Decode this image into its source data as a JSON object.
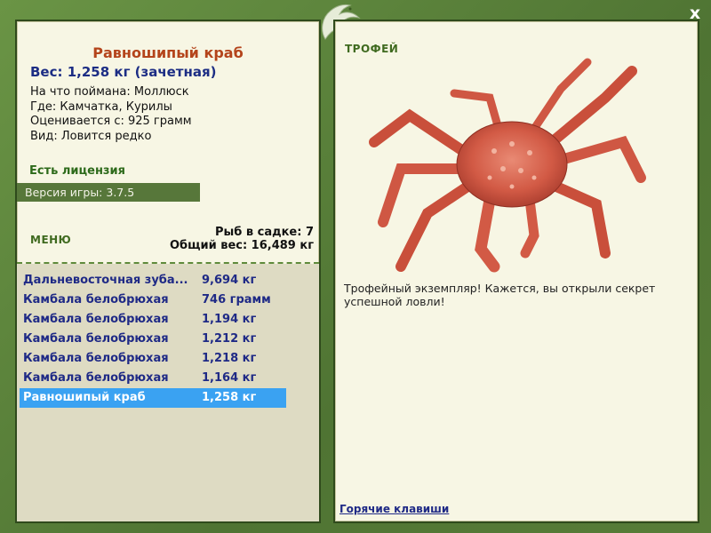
{
  "window": {
    "close_label": "x"
  },
  "fish": {
    "title": "Равношипый краб",
    "weight_line": "Вес: 1,258 кг (зачетная)",
    "info_lines": [
      "На что поймана: Моллюск",
      "Где: Камчатка, Курилы",
      "Оценивается с: 925 грамм",
      "Вид: Ловится редко"
    ]
  },
  "license_label": "Есть лицензия",
  "version_label": "Версия игры: 3.7.5",
  "menu_label": "МЕНЮ",
  "stats": {
    "fish_in_cage": "Рыб в садке: 7",
    "total_weight": "Общий вес: 16,489 кг"
  },
  "catch_list": [
    {
      "name": "Дальневосточная зуба...",
      "weight": "9,694 кг"
    },
    {
      "name": "Камбала белобрюхая",
      "weight": "746 грамм"
    },
    {
      "name": "Камбала белобрюхая",
      "weight": "1,194 кг"
    },
    {
      "name": "Камбала белобрюхая",
      "weight": "1,212 кг"
    },
    {
      "name": "Камбала белобрюхая",
      "weight": "1,218 кг"
    },
    {
      "name": "Камбала белобрюхая",
      "weight": "1,164 кг"
    },
    {
      "name": "Равношипый краб",
      "weight": "1,258 кг"
    }
  ],
  "selected_index": 6,
  "trophy": {
    "label": "ТРОФЕЙ",
    "message": "Трофейный экземпляр! Кажется, вы открыли секрет успешной ловли!"
  },
  "hotkeys_label": "Горячие клавиши",
  "colors": {
    "frame": "#5a7f3a",
    "panel": "#f7f6e4",
    "title": "#b4441b",
    "list_text": "#1f2a86",
    "selected_row": "#3aa2f2"
  },
  "icons": {
    "emblem": "fish-emblem-icon",
    "close": "close-icon",
    "trophy_image": "king-crab-image"
  }
}
